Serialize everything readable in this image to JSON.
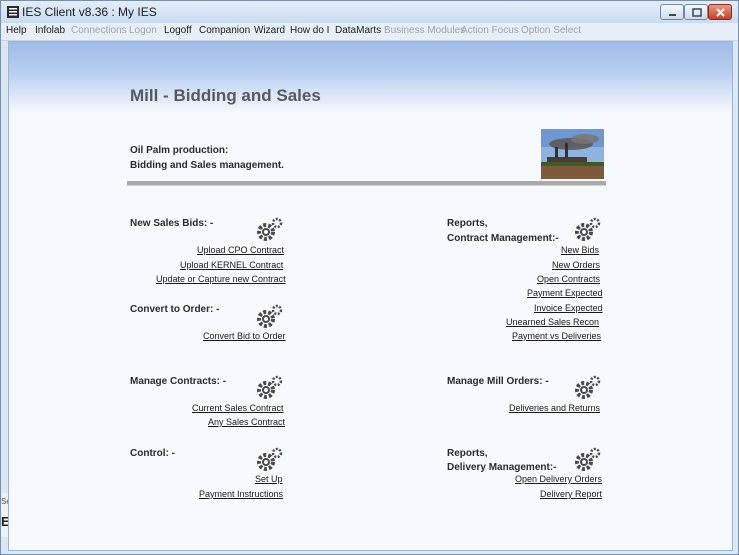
{
  "window": {
    "title": "IES Client v8.36 : My IES"
  },
  "menu": {
    "items": [
      {
        "label": "Help",
        "enabled": true
      },
      {
        "label": "Infolab",
        "enabled": true
      },
      {
        "label": "Connections",
        "enabled": false
      },
      {
        "label": "Logon",
        "enabled": false
      },
      {
        "label": "Logoff",
        "enabled": true
      },
      {
        "label": "Companion",
        "enabled": true
      },
      {
        "label": "Wizard",
        "enabled": true
      },
      {
        "label": "How do I",
        "enabled": true
      },
      {
        "label": "DataMarts",
        "enabled": true
      },
      {
        "label": "Business Modules",
        "enabled": false
      },
      {
        "label": "Action Focus",
        "enabled": false
      },
      {
        "label": "Option Select",
        "enabled": false
      }
    ]
  },
  "page": {
    "title": "Mill - Bidding and Sales",
    "intro_line1": "Oil Palm production:",
    "intro_line2": "Bidding and Sales management."
  },
  "sections": {
    "new_sales_bids": {
      "title": "New Sales Bids: -",
      "links": [
        "Upload CPO Contract",
        "Upload KERNEL Contract",
        "Update or Capture new Contract"
      ]
    },
    "convert_to_order": {
      "title": "Convert to Order: -",
      "links": [
        "Convert Bid to Order"
      ]
    },
    "manage_contracts": {
      "title": "Manage Contracts: -",
      "links": [
        "Current Sales Contract",
        "Any Sales Contract"
      ]
    },
    "control": {
      "title": "Control: -",
      "links": [
        "Set Up",
        "Payment Instructions"
      ]
    },
    "reports_contract": {
      "title_line1": "Reports,",
      "title_line2": "Contract Management:-",
      "links": [
        "New Bids",
        "New Orders",
        "Open Contracts",
        "Payment Expected",
        "Invoice Expected",
        "Unearned Sales Recon",
        "Payment vs Deliveries"
      ]
    },
    "manage_mill_orders": {
      "title": "Manage Mill Orders: -",
      "links": [
        "Deliveries and Returns"
      ]
    },
    "reports_delivery": {
      "title_line1": "Reports,",
      "title_line2": "Delivery Management:-",
      "links": [
        "Open Delivery Orders",
        "Delivery Report"
      ]
    }
  },
  "side_panel": {
    "tab_label": "Ses",
    "glyph": "E"
  },
  "colors": {
    "banner_top": "#9ebbe8",
    "page_title": "#555a60",
    "divider": "#a8a8a8"
  }
}
